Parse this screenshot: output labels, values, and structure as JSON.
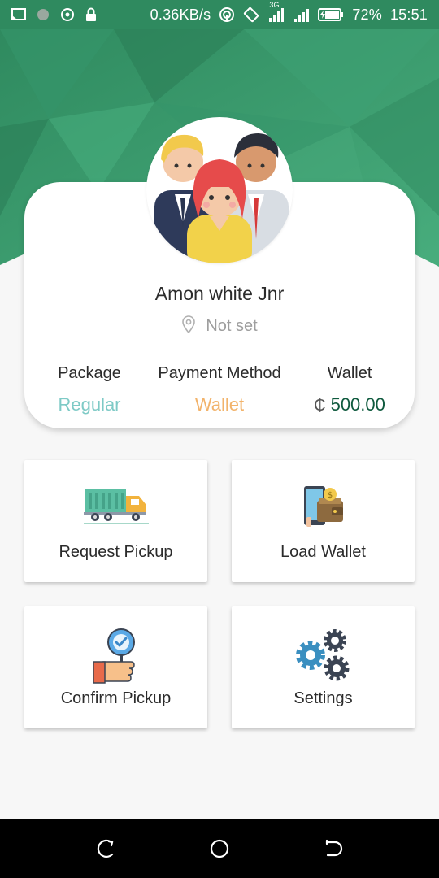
{
  "status_bar": {
    "speed": "0.36KB/s",
    "network_type": "3G",
    "battery": "72%",
    "time": "15:51",
    "icons": [
      "screen-cast-icon",
      "circle-notification-icon",
      "target-icon",
      "lock-icon",
      "hotspot-icon",
      "rotate-icon",
      "signal-3g-icon",
      "signal-icon",
      "battery-charging-icon"
    ]
  },
  "profile": {
    "name": "Amon white Jnr",
    "location": "Not set",
    "avatar": "people-group-avatar",
    "stats": {
      "package_label": "Package",
      "package_value": "Regular",
      "payment_label": "Payment Method",
      "payment_value": "Wallet",
      "wallet_label": "Wallet",
      "wallet_currency": "₵",
      "wallet_value": "500.00"
    }
  },
  "actions": [
    {
      "label": "Request Pickup",
      "icon": "garbage-truck-icon"
    },
    {
      "label": "Load Wallet",
      "icon": "phone-wallet-icon"
    },
    {
      "label": "Confirm Pickup",
      "icon": "hand-check-icon"
    },
    {
      "label": "Settings",
      "icon": "gears-icon"
    }
  ],
  "colors": {
    "header_green": "#3a9a6b",
    "package_value": "#7ecac6",
    "payment_value": "#f2b36b",
    "wallet_value": "#0f5a3e"
  },
  "nav_bar": {
    "buttons": [
      "recent-apps-icon",
      "home-icon",
      "back-icon"
    ]
  }
}
